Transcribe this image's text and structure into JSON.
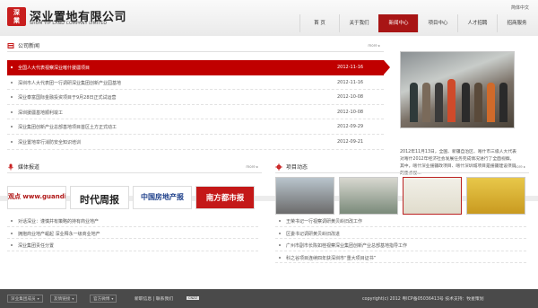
{
  "header": {
    "logo_seal": "深\n業",
    "company_cn": "深业置地有限公司",
    "company_en": "SHUM YIP LAND COMPANY LIMITED",
    "lang": "简体中文"
  },
  "nav": [
    {
      "label": "首 页",
      "active": false
    },
    {
      "label": "关于我们",
      "active": false
    },
    {
      "label": "新闻中心",
      "active": true
    },
    {
      "label": "项目中心",
      "active": false
    },
    {
      "label": "人才招聘",
      "active": false
    },
    {
      "label": "招商服务",
      "active": false
    }
  ],
  "company_news": {
    "title": "公司新闻",
    "more": "more",
    "items": [
      {
        "title": "全国人大代表视察深业喀什援疆项目",
        "date": "2012-11-16",
        "highlight": true
      },
      {
        "title": "深圳市人大代表团一行调研深业集团创新产业园基地",
        "date": "2012-11-16"
      },
      {
        "title": "深业泰富国际金融投资项目于9月28日正式试运营",
        "date": "2012-10-08"
      },
      {
        "title": "深圳援疆基地顺利竣工",
        "date": "2012-10-08"
      },
      {
        "title": "深业集团创新产业总部基地项目首区土方正式动工",
        "date": "2012-09-29"
      },
      {
        "title": "深业置地举行消防安全知识培训",
        "date": "2012-09-21"
      }
    ],
    "caption": "2012年11月13日，全国、新疆自治区、喀什市三级人大代表对喀什2012年经济社会发展任务完成情况进行了全面视察。其中，喀什深业援疆政项目、喀什深圳城项目是援疆建设项目的重点视..."
  },
  "media": {
    "title": "媒体报道",
    "more": "more",
    "logos": [
      {
        "name": "guandian-logo",
        "text": "观点 www.guandian.cn",
        "color": "#b01818"
      },
      {
        "name": "shidaizhoubao-logo",
        "text": "时代周报",
        "color": "#222"
      },
      {
        "name": "zhongguofangdichan-logo",
        "text": "中国房地产报",
        "color": "#1d3f8a"
      },
      {
        "name": "nanfangdushibao-logo",
        "text": "南方都市报",
        "color": "#fff"
      }
    ],
    "items": [
      {
        "title": "对话深业：谨慎并有策略的持有商业地产"
      },
      {
        "title": "拥抱商业地产崛起 深业释永一级商业地产"
      },
      {
        "title": "深业集团责任分置"
      }
    ]
  },
  "projects": {
    "title": "项目动态",
    "more": "more",
    "items": [
      {
        "title": "王荣书记一行视察调研黄贝岭旧改工作"
      },
      {
        "title": "区委书记调研黄贝岭旧改进"
      },
      {
        "title": "广州市副市长陈如桂视察深业集团创新产业总部基地指导工作"
      },
      {
        "title": "科之谷项目连续四年获深圳市“重大项目证书”"
      }
    ]
  },
  "footer": {
    "dropdowns": [
      "深业集团成员",
      "友情链接",
      "官方微博"
    ],
    "links": "新职信息 | 联系我们",
    "cnzz": "CNZZ",
    "copyright": "copyright(c)  2012    粤ICP备05036413号  技术支持：牧星策划"
  },
  "colors": {
    "accent": "#a81515",
    "highlight": "#c00000"
  }
}
